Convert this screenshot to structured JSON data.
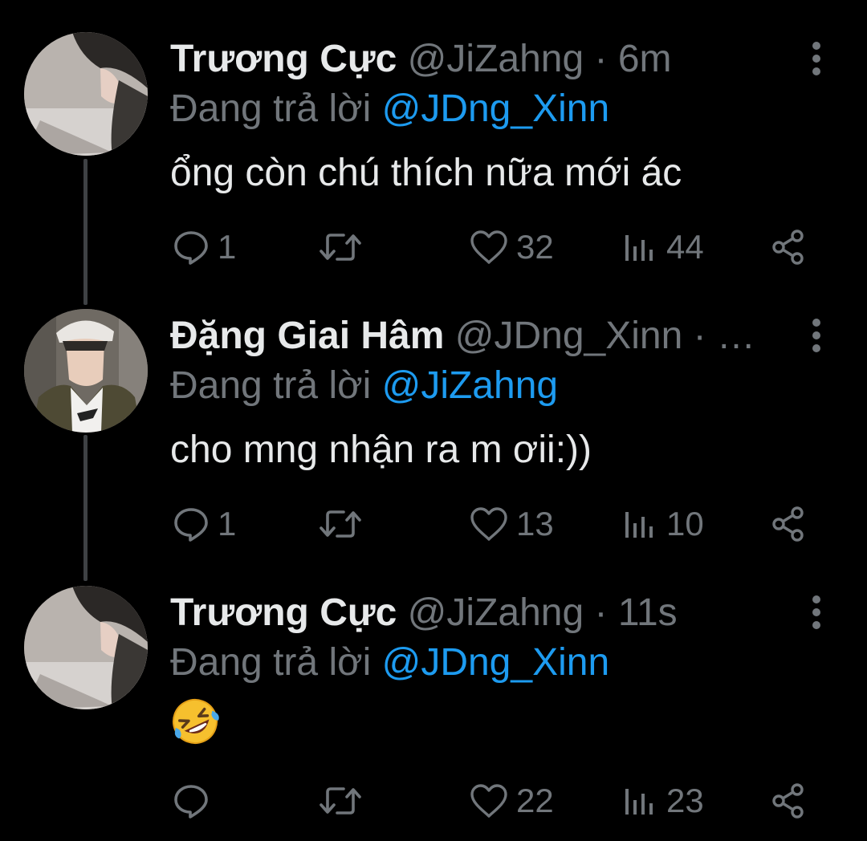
{
  "colors": {
    "background": "#000000",
    "primary_text": "#e7e9ea",
    "secondary_text": "#71767b",
    "mention": "#1d9bf0",
    "thread_line": "#3e4144"
  },
  "tweets": [
    {
      "name": "Trương Cực",
      "handle": "@JiZahng",
      "separator": "·",
      "time": "6m",
      "replying_to_prefix": "Đang trả lời",
      "replying_to": "@JDng_Xinn",
      "text": "ổng còn chú thích nữa mới ác",
      "replies": "1",
      "retweets": "",
      "likes": "32",
      "views": "44",
      "avatar_icon": "user-avatar"
    },
    {
      "name": "Đặng Giai Hâm",
      "handle": "@JDng_Xinn",
      "separator": "·",
      "time": "…",
      "replying_to_prefix": "Đang trả lời",
      "replying_to": "@JiZahng",
      "text": "cho mng nhận ra m ơii:))",
      "replies": "1",
      "retweets": "",
      "likes": "13",
      "views": "10",
      "avatar_icon": "user-avatar"
    },
    {
      "name": "Trương Cực",
      "handle": "@JiZahng",
      "separator": "·",
      "time": "11s",
      "replying_to_prefix": "Đang trả lời",
      "replying_to": "@JDng_Xinn",
      "text": "",
      "emoji": "rolling-on-floor-laughing-emoji",
      "replies": "",
      "retweets": "",
      "likes": "22",
      "views": "23",
      "avatar_icon": "user-avatar"
    }
  ],
  "icons": {
    "reply": "reply-icon",
    "retweet": "retweet-icon",
    "like": "heart-icon",
    "views": "views-icon",
    "share": "share-icon",
    "more": "more-vertical-icon"
  }
}
